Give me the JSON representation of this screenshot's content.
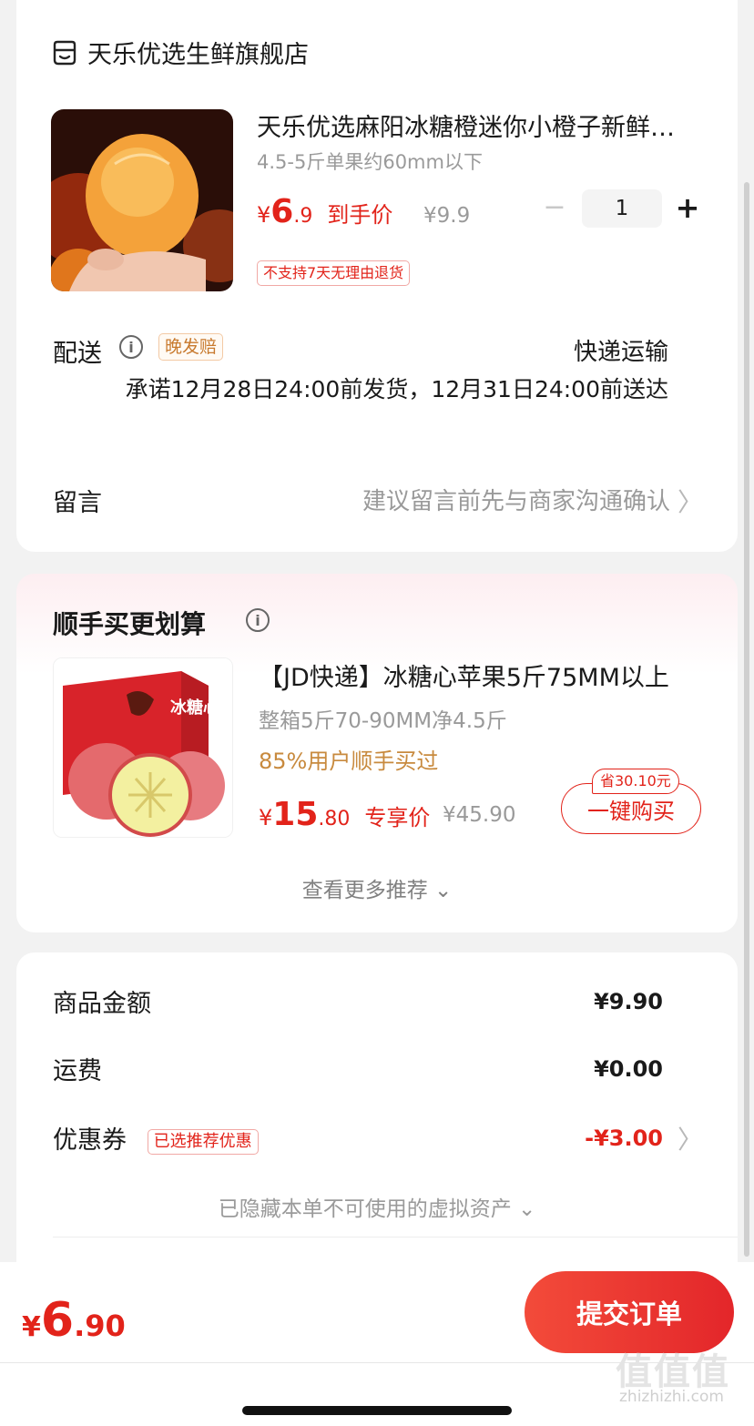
{
  "store": {
    "name": "天乐优选生鲜旗舰店",
    "icon": "store-icon"
  },
  "product": {
    "title": "天乐优选麻阳冰糖橙迷你小橙子新鲜水果",
    "spec": "4.5-5斤单果约60mm以下",
    "price_currency": "¥",
    "price_int": "6",
    "price_dec": ".9",
    "price_label": "到手价",
    "original_price": "¥9.9",
    "quantity": "1",
    "qty_minus": "−",
    "qty_plus": "+",
    "return_tag": "不支持7天无理由退货"
  },
  "delivery": {
    "label": "配送",
    "info_icon": "i",
    "late_tag": "晚发赔",
    "method": "快递运输",
    "promise": "承诺12月28日24:00前发货，12月31日24:00前送达"
  },
  "message": {
    "label": "留言",
    "hint": "建议留言前先与商家沟通确认",
    "chevron": "〉"
  },
  "recommend": {
    "title": "顺手买更划算",
    "info_icon": "i",
    "name": "【JD快递】冰糖心苹果5斤75MM以上",
    "spec": "整箱5斤70-90MM净4.5斤",
    "stat": "85%用户顺手买过",
    "price_currency": "¥",
    "price_int": "15",
    "price_dec": ".80",
    "price_label": "专享价",
    "original_price": "¥45.90",
    "save_badge": "省30.10元",
    "buy_label": "一键购买",
    "more": "查看更多推荐 ⌄",
    "box_text": "冰糖心"
  },
  "summary": {
    "goods_label": "商品金额",
    "goods_value": "¥9.90",
    "shipping_label": "运费",
    "shipping_value": "¥0.00",
    "coupon_label": "优惠券",
    "coupon_tag": "已选推荐优惠",
    "coupon_value": "-¥3.00",
    "chevron": "〉",
    "hidden_assets": "已隐藏本单不可使用的虚拟资产 ⌄"
  },
  "bottom": {
    "total_currency": "¥",
    "total_int": "6",
    "total_dec": ".90",
    "submit_label": "提交订单",
    "watermark": "值值值",
    "watermark_url": "zhizhizhi.com"
  },
  "colors": {
    "accent": "#e2231a",
    "gold": "#c88a3e",
    "muted": "#9a9a9a"
  }
}
